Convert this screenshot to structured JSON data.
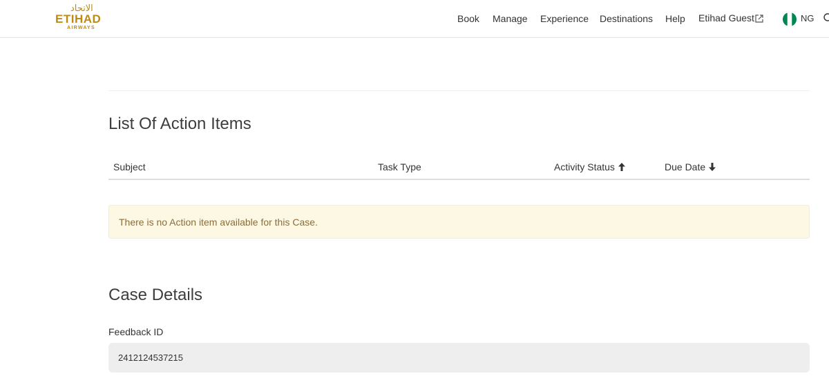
{
  "header": {
    "logo": {
      "arabic_text": "الاتحاد",
      "main_text": "ETIHAD",
      "sub_text": "AIRWAYS",
      "color": "#bd8b13"
    },
    "nav": {
      "book": "Book",
      "manage": "Manage",
      "experience": "Experience",
      "destinations": "Destinations",
      "help": "Help",
      "etihad_guest": "Etihad Guest"
    },
    "region": {
      "country_code": "NG",
      "flag_icon": "nigeria-flag-icon"
    },
    "icons": {
      "external_link": "external-link-icon",
      "search": "search-icon"
    }
  },
  "action_items": {
    "title": "List Of Action Items",
    "columns": {
      "subject": "Subject",
      "task_type": "Task Type",
      "activity_status": "Activity Status",
      "due_date": "Due Date"
    },
    "sort_icons": {
      "activity_status": "arrow-up-icon",
      "due_date": "arrow-down-icon"
    },
    "empty_message": "There is no Action item available for this Case."
  },
  "case_details": {
    "title": "Case Details",
    "feedback_id_label": "Feedback ID",
    "feedback_id_value": "2412124537215"
  },
  "colors": {
    "brand_gold": "#bd8b13",
    "notice_background": "#fcf8e3",
    "notice_text": "#8a6d3b",
    "field_background": "#eeeeee",
    "flag_green": "#008751"
  }
}
